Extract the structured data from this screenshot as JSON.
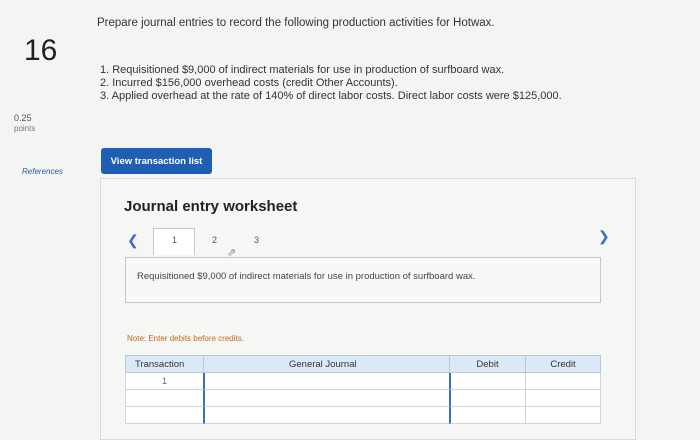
{
  "question": {
    "number": "16",
    "points_value": "0.25",
    "points_label": "points",
    "references_label": "References",
    "prompt": "Prepare journal entries to record the following production activities for Hotwax.",
    "steps": [
      "1. Requisitioned $9,000 of indirect materials for use in production of surfboard wax.",
      "2. Incurred $156,000 overhead costs (credit Other Accounts).",
      "3. Applied overhead at the rate of 140% of direct labor costs. Direct labor costs were $125,000."
    ],
    "view_button": "View transaction list"
  },
  "worksheet": {
    "title": "Journal entry worksheet",
    "pages": [
      "1",
      "2",
      "3"
    ],
    "active_page": "1",
    "prev_icon": "chevron-left-icon",
    "next_icon": "chevron-right-icon",
    "description": "Requisitioned $9,000 of indirect materials for use in production of surfboard wax.",
    "note": "Note: Enter debits before credits.",
    "columns": [
      "Transaction",
      "General Journal",
      "Debit",
      "Credit"
    ],
    "rows": [
      {
        "transaction": "1"
      },
      {
        "transaction": ""
      },
      {
        "transaction": ""
      }
    ]
  },
  "colors": {
    "button_blue": "#1f5fb3",
    "header_blue": "#dbe9f6",
    "note_orange": "#c06a1a"
  }
}
